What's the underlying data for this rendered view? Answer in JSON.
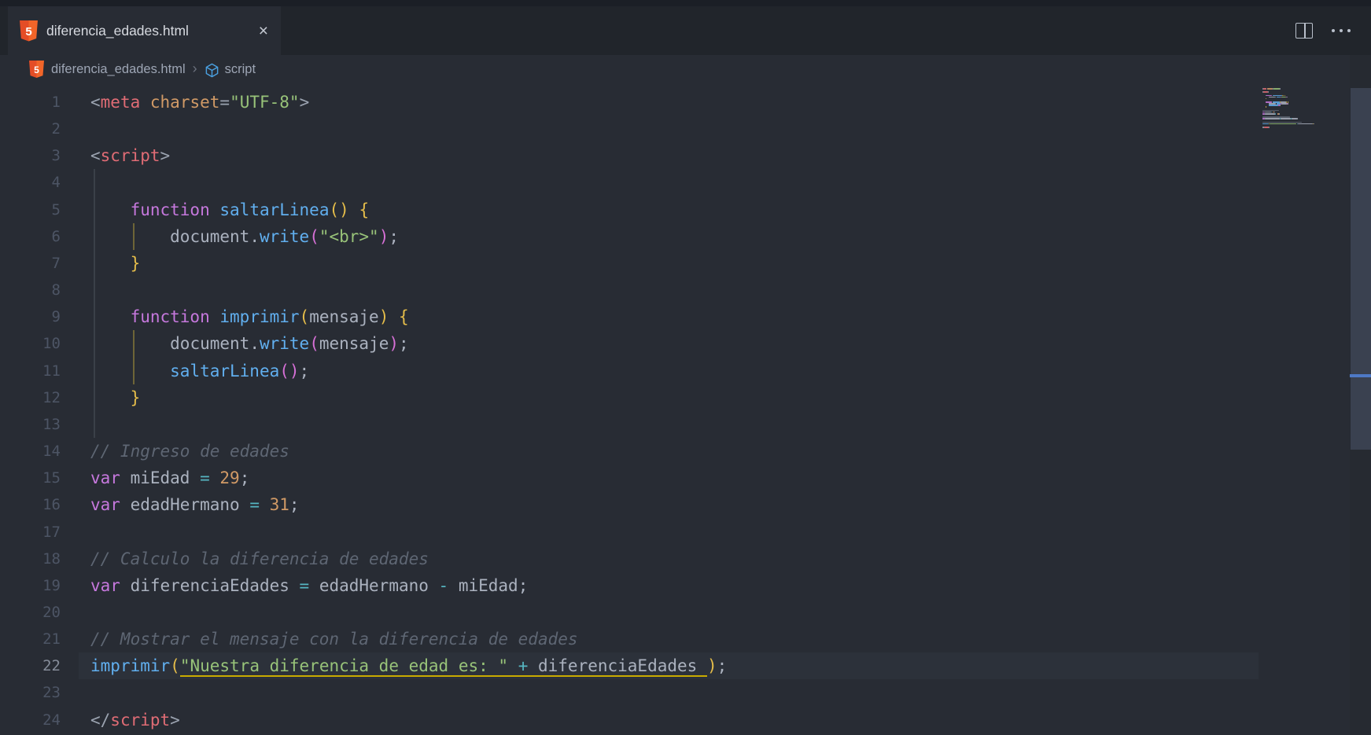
{
  "tab": {
    "title": "diferencia_edades.html",
    "close_glyph": "×"
  },
  "tabbar_actions": {
    "split_editor": "split-editor",
    "more_actions": "more-actions"
  },
  "breadcrumb": {
    "file": "diferencia_edades.html",
    "separator": "›",
    "symbol": "script"
  },
  "editor": {
    "language": "html",
    "current_line": 22,
    "colors": {
      "def": "#abb2bf",
      "kw": "#c678dd",
      "fn": "#61afef",
      "str": "#98c379",
      "num": "#d19a66",
      "attr": "#d19a66",
      "tag": "#e06c75",
      "pun": "#9ba3b0",
      "op": "#56b6c2",
      "com": "#5e6673",
      "b1": "#e5bd4a",
      "b2": "#d670d6",
      "line_number": "#4d5565",
      "line_number_active": "#858c99",
      "guide": "#3a4048",
      "guide_active": "#6e6537",
      "current_line_bg": "#2c313a",
      "underline": "#c9ab00"
    },
    "lines": [
      {
        "n": 1,
        "g": 0,
        "tk": [
          {
            "t": "<",
            "c": "pun"
          },
          {
            "t": "meta",
            "c": "tag"
          },
          {
            "t": " ",
            "c": "def"
          },
          {
            "t": "charset",
            "c": "attr"
          },
          {
            "t": "=",
            "c": "pun"
          },
          {
            "t": "\"UTF-8\"",
            "c": "str"
          },
          {
            "t": ">",
            "c": "pun"
          }
        ]
      },
      {
        "n": 2,
        "g": 0,
        "tk": []
      },
      {
        "n": 3,
        "g": 0,
        "tk": [
          {
            "t": "<",
            "c": "pun"
          },
          {
            "t": "script",
            "c": "tag"
          },
          {
            "t": ">",
            "c": "pun"
          }
        ]
      },
      {
        "n": 4,
        "g": 1,
        "tk": []
      },
      {
        "n": 5,
        "g": 1,
        "tk": [
          {
            "t": "    ",
            "c": "def"
          },
          {
            "t": "function",
            "c": "kw"
          },
          {
            "t": " ",
            "c": "def"
          },
          {
            "t": "saltarLinea",
            "c": "fn"
          },
          {
            "t": "(",
            "c": "b1"
          },
          {
            "t": ")",
            "c": "b1"
          },
          {
            "t": " ",
            "c": "def"
          },
          {
            "t": "{",
            "c": "b1"
          }
        ]
      },
      {
        "n": 6,
        "g": 2,
        "tk": [
          {
            "t": "        ",
            "c": "def"
          },
          {
            "t": "document",
            "c": "def"
          },
          {
            "t": ".",
            "c": "def"
          },
          {
            "t": "write",
            "c": "fn"
          },
          {
            "t": "(",
            "c": "b2"
          },
          {
            "t": "\"<br>\"",
            "c": "str"
          },
          {
            "t": ")",
            "c": "b2"
          },
          {
            "t": ";",
            "c": "def"
          }
        ]
      },
      {
        "n": 7,
        "g": 1,
        "tk": [
          {
            "t": "    ",
            "c": "def"
          },
          {
            "t": "}",
            "c": "b1"
          }
        ]
      },
      {
        "n": 8,
        "g": 1,
        "tk": []
      },
      {
        "n": 9,
        "g": 1,
        "tk": [
          {
            "t": "    ",
            "c": "def"
          },
          {
            "t": "function",
            "c": "kw"
          },
          {
            "t": " ",
            "c": "def"
          },
          {
            "t": "imprimir",
            "c": "fn"
          },
          {
            "t": "(",
            "c": "b1"
          },
          {
            "t": "mensaje",
            "c": "def"
          },
          {
            "t": ")",
            "c": "b1"
          },
          {
            "t": " ",
            "c": "def"
          },
          {
            "t": "{",
            "c": "b1"
          }
        ]
      },
      {
        "n": 10,
        "g": 2,
        "tk": [
          {
            "t": "        ",
            "c": "def"
          },
          {
            "t": "document",
            "c": "def"
          },
          {
            "t": ".",
            "c": "def"
          },
          {
            "t": "write",
            "c": "fn"
          },
          {
            "t": "(",
            "c": "b2"
          },
          {
            "t": "mensaje",
            "c": "def"
          },
          {
            "t": ")",
            "c": "b2"
          },
          {
            "t": ";",
            "c": "def"
          }
        ]
      },
      {
        "n": 11,
        "g": 2,
        "tk": [
          {
            "t": "        ",
            "c": "def"
          },
          {
            "t": "saltarLinea",
            "c": "fn"
          },
          {
            "t": "(",
            "c": "b2"
          },
          {
            "t": ")",
            "c": "b2"
          },
          {
            "t": ";",
            "c": "def"
          }
        ]
      },
      {
        "n": 12,
        "g": 1,
        "tk": [
          {
            "t": "    ",
            "c": "def"
          },
          {
            "t": "}",
            "c": "b1"
          }
        ]
      },
      {
        "n": 13,
        "g": 1,
        "tk": []
      },
      {
        "n": 14,
        "g": 0,
        "tk": [
          {
            "t": "// Ingreso de edades",
            "c": "com"
          }
        ]
      },
      {
        "n": 15,
        "g": 0,
        "tk": [
          {
            "t": "var",
            "c": "kw"
          },
          {
            "t": " miEdad ",
            "c": "def"
          },
          {
            "t": "=",
            "c": "op"
          },
          {
            "t": " ",
            "c": "def"
          },
          {
            "t": "29",
            "c": "num"
          },
          {
            "t": ";",
            "c": "def"
          }
        ]
      },
      {
        "n": 16,
        "g": 0,
        "tk": [
          {
            "t": "var",
            "c": "kw"
          },
          {
            "t": " edadHermano ",
            "c": "def"
          },
          {
            "t": "=",
            "c": "op"
          },
          {
            "t": " ",
            "c": "def"
          },
          {
            "t": "31",
            "c": "num"
          },
          {
            "t": ";",
            "c": "def"
          }
        ]
      },
      {
        "n": 17,
        "g": 0,
        "tk": []
      },
      {
        "n": 18,
        "g": 0,
        "tk": [
          {
            "t": "// Calculo la diferencia de edades",
            "c": "com"
          }
        ]
      },
      {
        "n": 19,
        "g": 0,
        "tk": [
          {
            "t": "var",
            "c": "kw"
          },
          {
            "t": " diferenciaEdades ",
            "c": "def"
          },
          {
            "t": "=",
            "c": "op"
          },
          {
            "t": " edadHermano ",
            "c": "def"
          },
          {
            "t": "-",
            "c": "op"
          },
          {
            "t": " miEdad",
            "c": "def"
          },
          {
            "t": ";",
            "c": "def"
          }
        ]
      },
      {
        "n": 20,
        "g": 0,
        "tk": []
      },
      {
        "n": 21,
        "g": 0,
        "tk": [
          {
            "t": "// Mostrar el mensaje con la diferencia de edades",
            "c": "com"
          }
        ]
      },
      {
        "n": 22,
        "g": 0,
        "tk": [
          {
            "t": "imprimir",
            "c": "fn"
          },
          {
            "t": "(",
            "c": "b1"
          },
          {
            "t": "\"Nuestra diferencia de edad es: \"",
            "c": "str",
            "u": true
          },
          {
            "t": " ",
            "c": "def",
            "u": true
          },
          {
            "t": "+",
            "c": "op",
            "u": true
          },
          {
            "t": " diferenciaEdades ",
            "c": "def",
            "u": true
          },
          {
            "t": ")",
            "c": "b1"
          },
          {
            "t": ";",
            "c": "def"
          }
        ]
      },
      {
        "n": 23,
        "g": 0,
        "tk": []
      },
      {
        "n": 24,
        "g": 0,
        "tk": [
          {
            "t": "</",
            "c": "pun"
          },
          {
            "t": "script",
            "c": "tag"
          },
          {
            "t": ">",
            "c": "pun"
          }
        ]
      }
    ]
  },
  "scrollbar": {
    "thumb_color": "#3a4150",
    "cursor_marker_color": "#4e79c6"
  }
}
